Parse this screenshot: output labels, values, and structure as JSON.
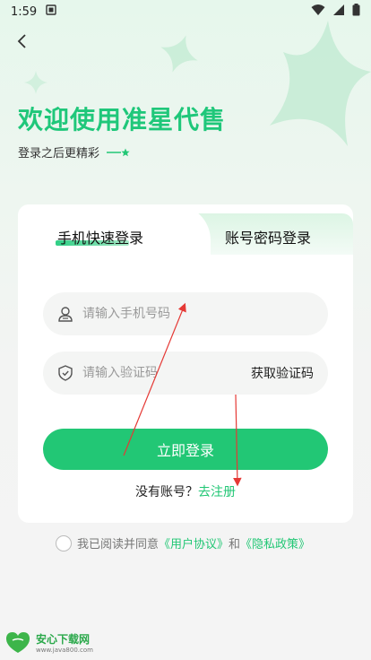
{
  "status_bar": {
    "time": "1:59"
  },
  "hero": {
    "title": "欢迎使用准星代售",
    "subtitle": "登录之后更精彩"
  },
  "tabs": [
    {
      "label": "手机快速登录",
      "active": true
    },
    {
      "label": "账号密码登录",
      "active": false
    }
  ],
  "form": {
    "phone_placeholder": "请输入手机号码",
    "code_placeholder": "请输入验证码",
    "get_code_label": "获取验证码",
    "login_label": "立即登录"
  },
  "register": {
    "prompt": "没有账号？",
    "link": "去注册"
  },
  "agreement": {
    "text_before": "我已阅读并同意",
    "user_agreement": "《用户协议》",
    "and": "和",
    "privacy_policy": "《隐私政策》"
  },
  "watermark": {
    "name": "安心下载网",
    "url": "www.java800.com"
  },
  "colors": {
    "accent": "#22c775",
    "title": "#1fc77a",
    "annotation_arrow": "#e53935"
  }
}
